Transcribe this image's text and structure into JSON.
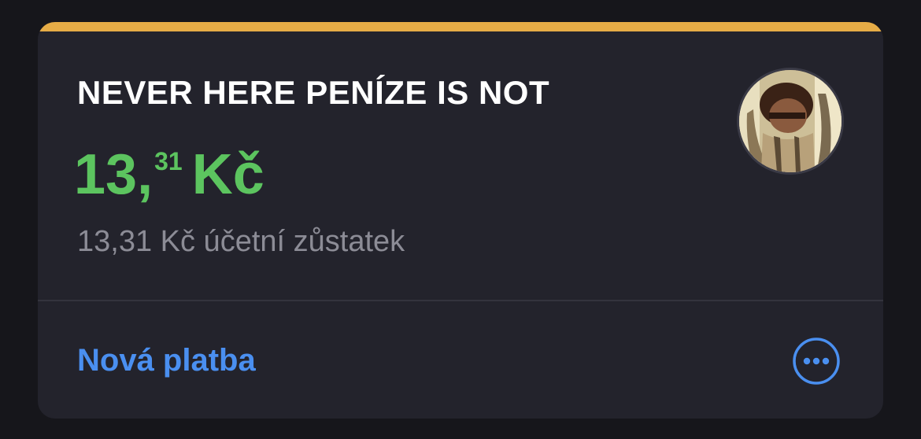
{
  "card": {
    "accent_color": "#e6ac46",
    "title": "NEVER HERE PENÍZE IS NOT",
    "balance": {
      "integer": "13",
      "separator": ",",
      "decimal": "31",
      "currency": "Kč",
      "color": "#5cc45f"
    },
    "accounting_balance": "13,31 Kč účetní zůstatek",
    "avatar": "user-photo"
  },
  "actions": {
    "new_payment_label": "Nová platba",
    "more_icon": "more-horizontal-icon",
    "link_color": "#4a8ff0"
  }
}
